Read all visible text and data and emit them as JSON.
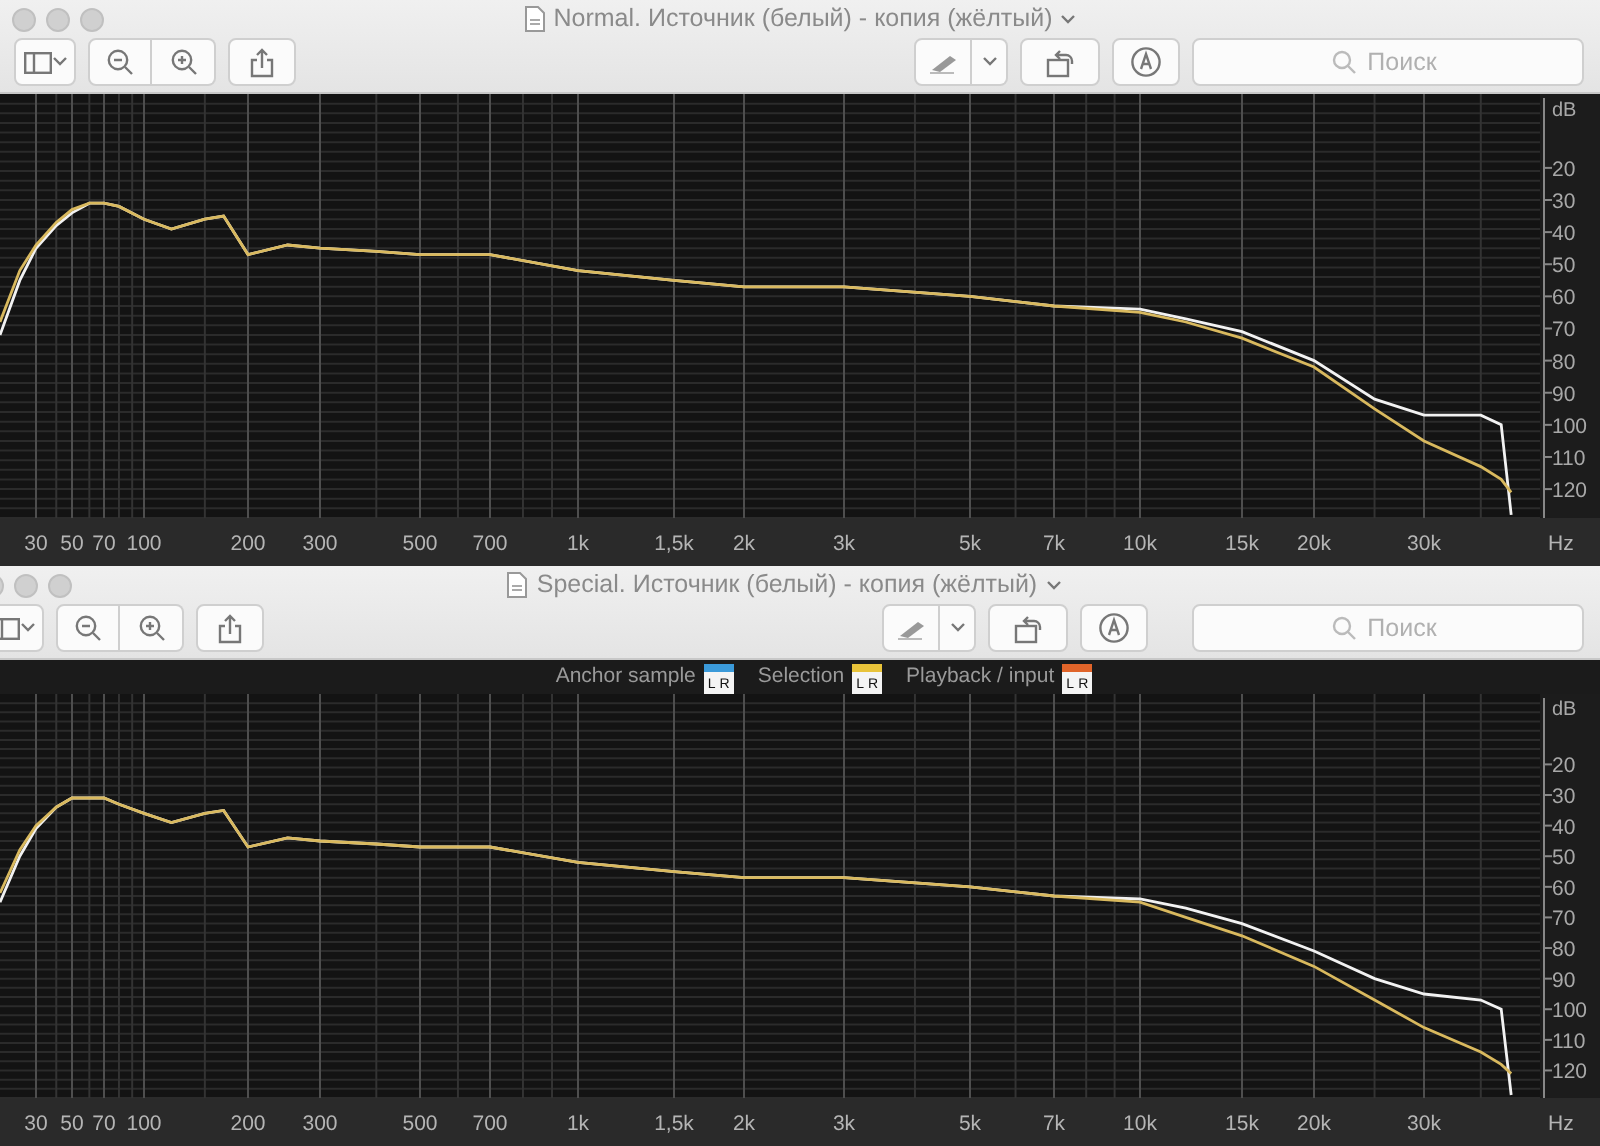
{
  "windows": [
    {
      "title": "Normal. Источник (белый) - копия (жёлтый)",
      "search": {
        "placeholder": "Поиск"
      },
      "spectrum": {
        "frequency_labels": [
          "30",
          "50",
          "70",
          "100",
          "200",
          "300",
          "500",
          "700",
          "1k",
          "1,5k",
          "2k",
          "3k",
          "5k",
          "7k",
          "10k",
          "15k",
          "20k",
          "30k"
        ],
        "frequency_unit": "Hz",
        "level_unit": "dB",
        "level_labels": [
          "20",
          "30",
          "40",
          "50",
          "60",
          "70",
          "80",
          "90",
          "100",
          "110",
          "120"
        ]
      }
    },
    {
      "title": "Special. Источник (белый) - копия (жёлтый)",
      "search": {
        "placeholder": "Поиск"
      },
      "legend": [
        {
          "label": "Anchor sample",
          "left": "L",
          "right": "R",
          "color": "#3b9ad9"
        },
        {
          "label": "Selection",
          "left": "L",
          "right": "R",
          "color": "#e8c33a"
        },
        {
          "label": "Playback / input",
          "left": "L",
          "right": "R",
          "color": "#e0642a"
        }
      ],
      "spectrum": {
        "frequency_labels": [
          "30",
          "50",
          "70",
          "100",
          "200",
          "300",
          "500",
          "700",
          "1k",
          "1,5k",
          "2k",
          "3k",
          "5k",
          "7k",
          "10k",
          "15k",
          "20k",
          "30k"
        ],
        "frequency_unit": "Hz",
        "level_unit": "dB",
        "level_labels": [
          "20",
          "30",
          "40",
          "50",
          "60",
          "70",
          "80",
          "90",
          "100",
          "110",
          "120"
        ]
      }
    }
  ]
}
